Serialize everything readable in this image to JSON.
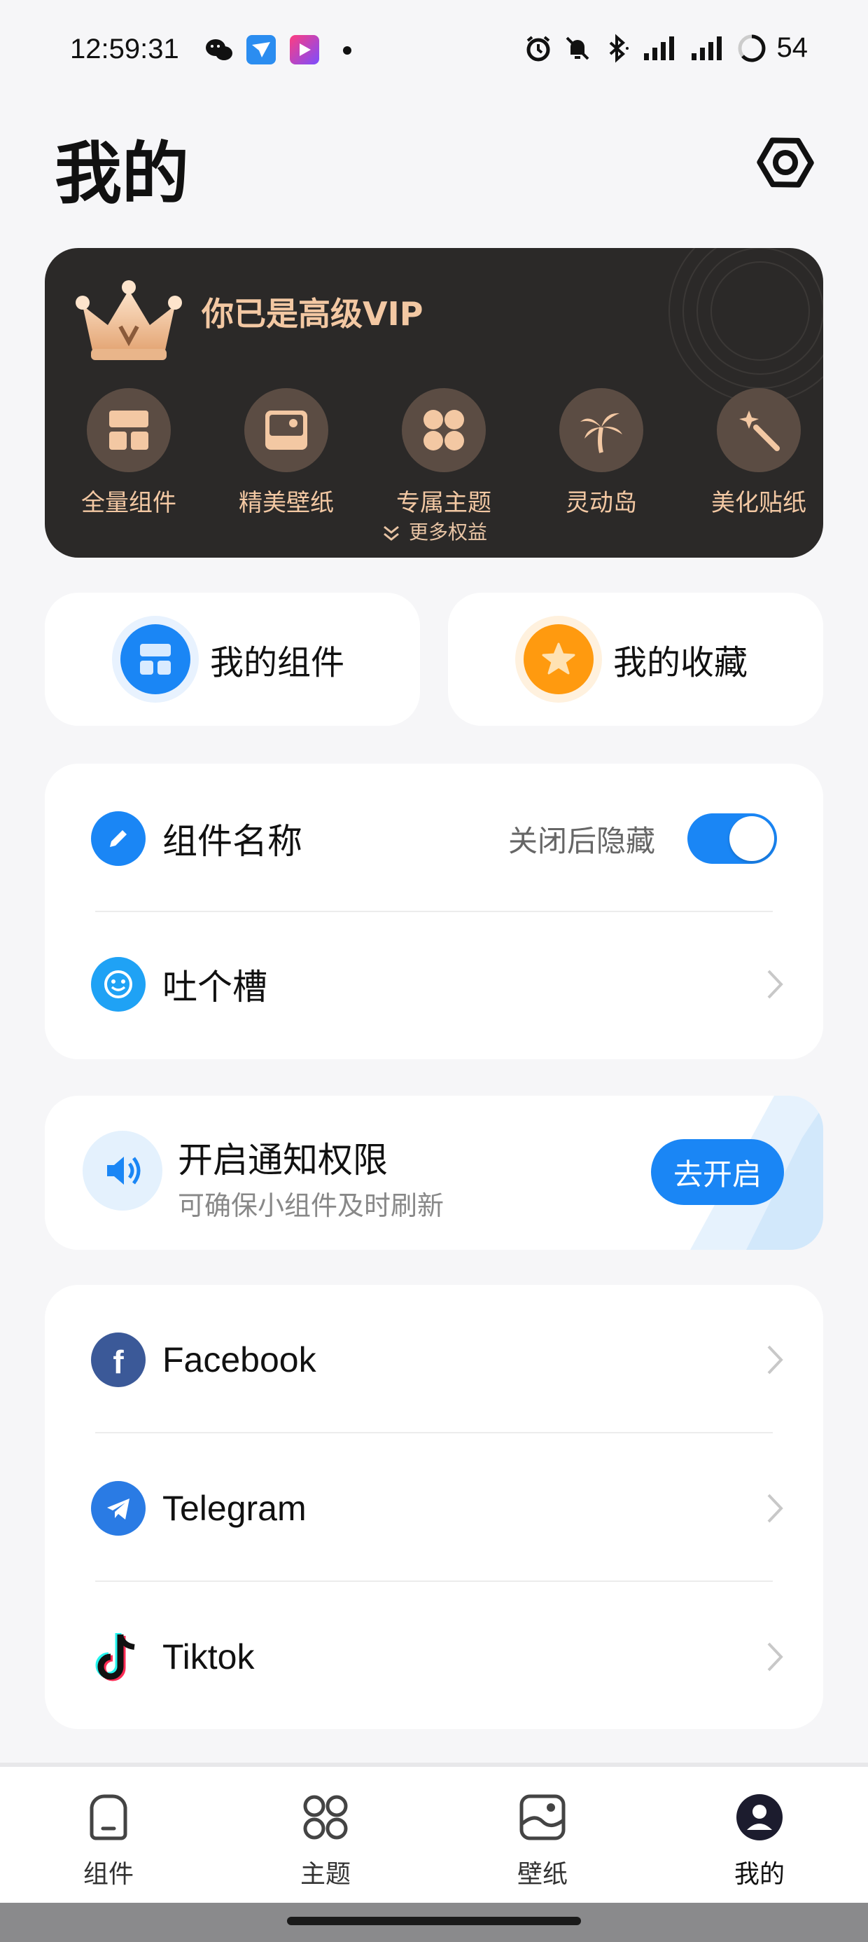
{
  "status_bar": {
    "time": "12:59:31",
    "battery": "54",
    "icons": [
      "wechat-icon",
      "messenger-app-icon",
      "video-app-icon",
      "dot-icon",
      "alarm-icon",
      "mute-icon",
      "bluetooth-icon",
      "signal-icon",
      "signal-icon",
      "battery-icon"
    ]
  },
  "header": {
    "title": "我的"
  },
  "vip": {
    "title": "你已是高级VIP",
    "items": [
      {
        "label": "全量组件",
        "icon": "widgets-icon"
      },
      {
        "label": "精美壁纸",
        "icon": "wallpaper-icon"
      },
      {
        "label": "专属主题",
        "icon": "theme-icon"
      },
      {
        "label": "灵动岛",
        "icon": "palm-tree-icon"
      },
      {
        "label": "美化贴纸",
        "icon": "magic-wand-icon"
      }
    ],
    "more": "更多权益"
  },
  "quick": {
    "widgets": "我的组件",
    "favorites": "我的收藏"
  },
  "settings": {
    "widget_name": "组件名称",
    "toggle_hint": "关闭后隐藏",
    "toggle_on": true,
    "feedback": "吐个槽"
  },
  "notify": {
    "title": "开启通知权限",
    "subtitle": "可确保小组件及时刷新",
    "button": "去开启"
  },
  "social": [
    {
      "label": "Facebook",
      "icon": "facebook-icon"
    },
    {
      "label": "Telegram",
      "icon": "telegram-icon"
    },
    {
      "label": "Tiktok",
      "icon": "tiktok-icon"
    }
  ],
  "tabs": [
    {
      "label": "组件",
      "active": false
    },
    {
      "label": "主题",
      "active": false
    },
    {
      "label": "壁纸",
      "active": false
    },
    {
      "label": "我的",
      "active": true
    }
  ],
  "colors": {
    "accent": "#1a86f5",
    "vip_bg": "#2b2928",
    "vip_text": "#f3c8a3",
    "favorite": "#ff9a0f",
    "page_bg": "#f6f6f8"
  }
}
